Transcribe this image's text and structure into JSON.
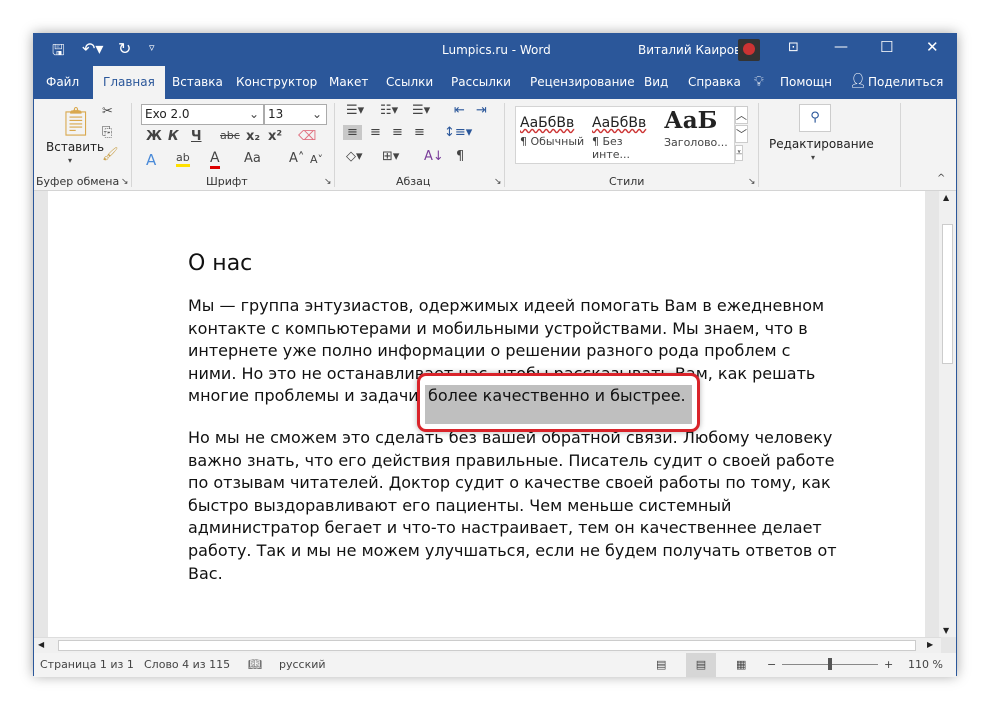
{
  "titlebar": {
    "title": "Lumpics.ru  -  Word",
    "user": "Виталий Каиров"
  },
  "tabs": [
    "Файл",
    "Главная",
    "Вставка",
    "Конструктор",
    "Макет",
    "Ссылки",
    "Рассылки",
    "Рецензирование",
    "Вид",
    "Справка",
    "Помощн",
    "Поделиться"
  ],
  "ribbon": {
    "clipboard": {
      "paste": "Вставить",
      "label": "Буфер обмена"
    },
    "font": {
      "name": "Exo 2.0",
      "size": "13",
      "bold": "Ж",
      "italic": "К",
      "underline": "Ч",
      "strike": "abc",
      "sub": "x₂",
      "sup": "x²",
      "case": "Aa",
      "label": "Шрифт"
    },
    "paragraph": {
      "label": "Абзац"
    },
    "styles": {
      "items": [
        {
          "sample": "АаБбВв",
          "name": "¶ Обычный"
        },
        {
          "sample": "АаБбВв",
          "name": "¶ Без инте..."
        },
        {
          "sample": "АаБ",
          "name": "Заголово..."
        }
      ],
      "label": "Стили"
    },
    "editing": {
      "label": "Редактирование"
    }
  },
  "document": {
    "heading": "О нас",
    "p1": [
      "Мы — группа энтузиастов, одержимых идеей помогать Вам в ежедневном",
      "контакте с компьютерами и мобильными устройствами. Мы знаем, что в",
      "интернете уже полно информации о решении разного рода проблем с",
      "ними. Но это не останавливает нас, чтобы рассказывать Вам, как решать",
      "многие проблемы и задачи более качественно и быстрее."
    ],
    "p2": [
      "Но мы не сможем это сделать без вашей обратной связи. Любому человеку",
      "важно знать, что его действия правильные. Писатель судит о своей работе",
      "по отзывам читателей. Доктор судит о качестве своей работы по тому, как",
      "быстро выздоравливают его пациенты. Чем меньше системный",
      "администратор бегает и что-то настраивает, тем он качественнее делает",
      "работу. Так и мы не можем улучшаться, если не будем получать ответов от",
      "Вас."
    ],
    "highlight": "более качественно и быстрее."
  },
  "status": {
    "page": "Страница 1 из 1",
    "words": "Слово 4 из 115",
    "language": "русский",
    "zoom": "110 %",
    "zoom_value": 110
  },
  "colors": {
    "accent": "#2b579a",
    "highlight_border": "#d9232a"
  }
}
